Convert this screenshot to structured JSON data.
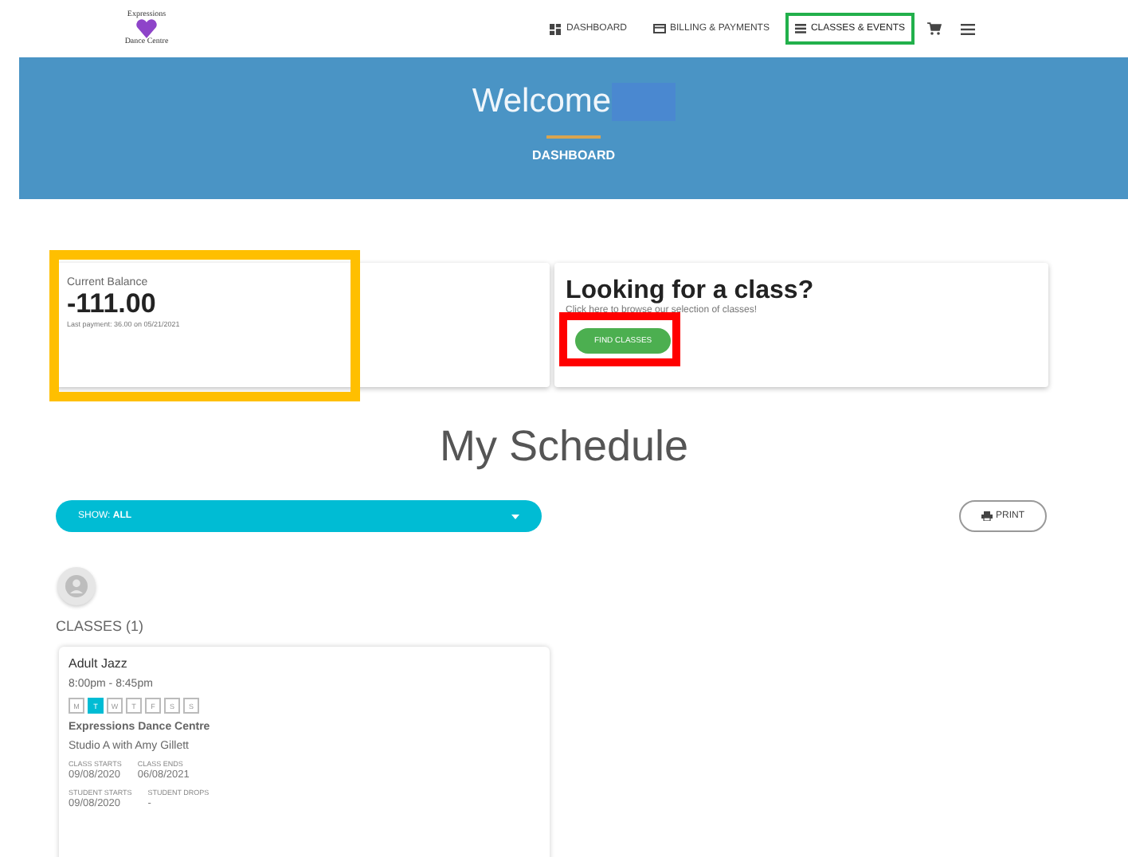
{
  "header": {
    "logo": {
      "top": "Expressions",
      "bottom": "Dance Centre"
    },
    "nav": [
      {
        "kind": "dashboard",
        "label": "DASHBOARD",
        "selected": false
      },
      {
        "kind": "billing",
        "label": "BILLING & PAYMENTS",
        "selected": false
      },
      {
        "kind": "classes",
        "label": "CLASSES & EVENTS",
        "selected": true,
        "highlight": {
          "color": "#22b04b"
        }
      }
    ]
  },
  "hero": {
    "title": "Welcome",
    "name_redacted": true,
    "subtitle": "DASHBOARD"
  },
  "balance_card": {
    "label": "Current Balance",
    "amount": "-111.00",
    "last_payment": "Last payment: 36.00 on 05/21/2021",
    "highlight": {
      "color": "#ffbf00"
    }
  },
  "class_card": {
    "title": "Looking for a class?",
    "text": "Click here to browse our selection of classes!",
    "button": "FIND CLASSES",
    "button_highlight": {
      "color": "#ff0000"
    }
  },
  "schedule": {
    "title": "My Schedule",
    "filter": {
      "prefix": "SHOW:",
      "value": "ALL"
    },
    "print": "PRINT",
    "section": "CLASSES (1)",
    "classes": [
      {
        "name": "Adult Jazz",
        "time": "8:00pm - 8:45pm",
        "days": [
          {
            "label": "M",
            "selected": false
          },
          {
            "label": "T",
            "selected": true
          },
          {
            "label": "W",
            "selected": false
          },
          {
            "label": "T",
            "selected": false
          },
          {
            "label": "F",
            "selected": false
          },
          {
            "label": "S",
            "selected": false
          },
          {
            "label": "S",
            "selected": false
          }
        ],
        "school": "Expressions Dance Centre",
        "studio": "Studio A with Amy Gillett",
        "dates": [
          [
            {
              "label": "CLASS STARTS",
              "value": "09/08/2020"
            },
            {
              "label": "CLASS ENDS",
              "value": "06/08/2021"
            }
          ],
          [
            {
              "label": "STUDENT STARTS",
              "value": "09/08/2020"
            },
            {
              "label": "STUDENT DROPS",
              "value": "-"
            }
          ]
        ]
      }
    ]
  }
}
